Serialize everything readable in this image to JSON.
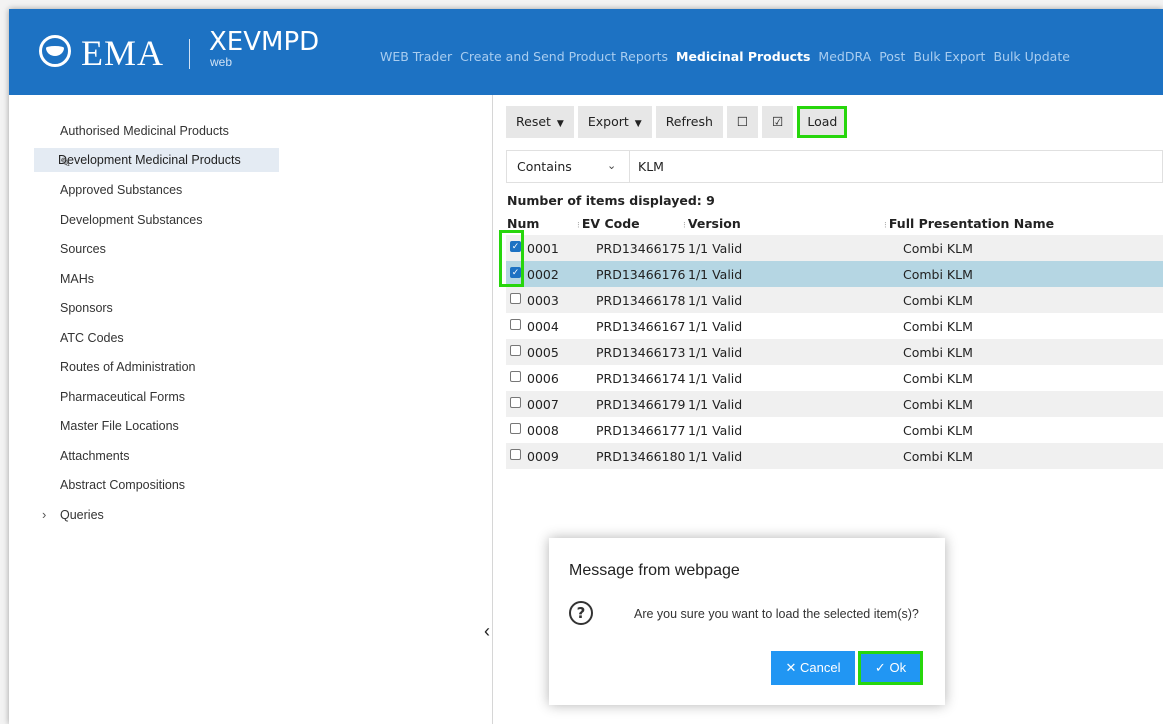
{
  "header": {
    "logo_main": "EMA",
    "logo_sub": "XEVMPD",
    "logo_sub_small": "web",
    "nav": [
      {
        "label": "WEB Trader",
        "active": false
      },
      {
        "label": "Create and Send Product Reports",
        "active": false
      },
      {
        "label": "Medicinal Products",
        "active": true
      },
      {
        "label": "MedDRA",
        "active": false
      },
      {
        "label": "Post",
        "active": false
      },
      {
        "label": "Bulk Export",
        "active": false
      },
      {
        "label": "Bulk Update",
        "active": false
      }
    ]
  },
  "sidebar": {
    "items": [
      {
        "label": "Authorised Medicinal Products"
      },
      {
        "label": "Development Medicinal Products",
        "active": true
      },
      {
        "label": "Approved Substances"
      },
      {
        "label": "Development Substances"
      },
      {
        "label": "Sources"
      },
      {
        "label": "MAHs"
      },
      {
        "label": "Sponsors"
      },
      {
        "label": "ATC Codes"
      },
      {
        "label": "Routes of Administration"
      },
      {
        "label": "Pharmaceutical Forms"
      },
      {
        "label": "Master File Locations"
      },
      {
        "label": "Attachments"
      },
      {
        "label": "Abstract Compositions"
      },
      {
        "label": "Queries"
      }
    ]
  },
  "toolbar": {
    "reset_label": "Reset",
    "export_label": "Export",
    "refresh_label": "Refresh",
    "uncheck_label": "☐",
    "check_label": "☑",
    "load_label": "Load"
  },
  "filter": {
    "mode": "Contains",
    "value": "KLM"
  },
  "table": {
    "count_label": "Number of items displayed: 9",
    "headers": {
      "num": "Num",
      "ev_code": "EV Code",
      "version": "Version",
      "full_name": "Full Presentation Name"
    },
    "rows": [
      {
        "num": "0001",
        "ev_code": "PRD13466175",
        "version": "1/1 Valid",
        "name": "Combi KLM",
        "checked": true
      },
      {
        "num": "0002",
        "ev_code": "PRD13466176",
        "version": "1/1 Valid",
        "name": "Combi KLM",
        "checked": true
      },
      {
        "num": "0003",
        "ev_code": "PRD13466178",
        "version": "1/1 Valid",
        "name": "Combi KLM",
        "checked": false
      },
      {
        "num": "0004",
        "ev_code": "PRD13466167",
        "version": "1/1 Valid",
        "name": "Combi KLM",
        "checked": false
      },
      {
        "num": "0005",
        "ev_code": "PRD13466173",
        "version": "1/1 Valid",
        "name": "Combi KLM",
        "checked": false
      },
      {
        "num": "0006",
        "ev_code": "PRD13466174",
        "version": "1/1 Valid",
        "name": "Combi KLM",
        "checked": false
      },
      {
        "num": "0007",
        "ev_code": "PRD13466179",
        "version": "1/1 Valid",
        "name": "Combi KLM",
        "checked": false
      },
      {
        "num": "0008",
        "ev_code": "PRD13466177",
        "version": "1/1 Valid",
        "name": "Combi KLM",
        "checked": false
      },
      {
        "num": "0009",
        "ev_code": "PRD13466180",
        "version": "1/1 Valid",
        "name": "Combi KLM",
        "checked": false
      }
    ]
  },
  "dialog": {
    "title": "Message from webpage",
    "message": "Are you sure you want to load the selected item(s)?",
    "cancel_label": "Cancel",
    "ok_label": "Ok"
  },
  "colors": {
    "brand": "#1d72c3",
    "highlight": "#27d60c",
    "button": "#2196f3"
  }
}
